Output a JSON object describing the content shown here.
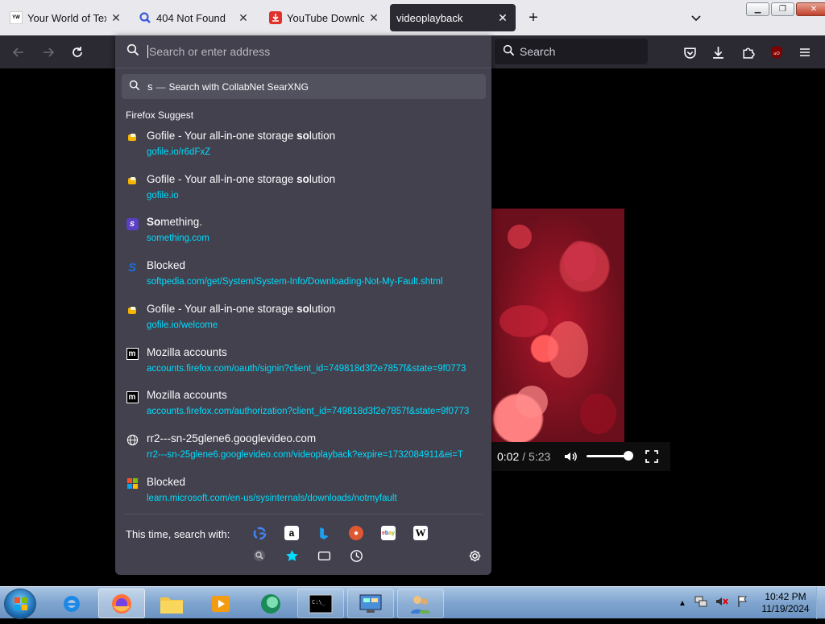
{
  "tabs": [
    {
      "title": "Your World of Text",
      "favicon_text": "YW\nOT"
    },
    {
      "title": "404 Not Found",
      "favicon": "search-icon"
    },
    {
      "title": "YouTube Download",
      "favicon": "download-icon"
    },
    {
      "title": "videoplayback",
      "active": true
    }
  ],
  "navbar": {
    "search_placeholder": "Search"
  },
  "urlbar": {
    "placeholder": "Search or enter address",
    "first_row": {
      "query": "s",
      "separator": "—",
      "action": "Search with CollabNet SearXNG"
    },
    "suggest_header": "Firefox Suggest",
    "results": [
      {
        "title_pre": "Gofile - Your all-in-one storage ",
        "title_bold": "so",
        "title_post": "lution",
        "url": "gofile.io/r6dFxZ",
        "icon": "gofile-icon"
      },
      {
        "title_pre": "Gofile - Your all-in-one storage ",
        "title_bold": "so",
        "title_post": "lution",
        "url": "gofile.io",
        "icon": "gofile-icon"
      },
      {
        "title_pre": "",
        "title_bold": "So",
        "title_post": "mething.",
        "url": "something.com",
        "icon": "something-icon"
      },
      {
        "title_pre": "Blocked",
        "title_bold": "",
        "title_post": "",
        "url": "softpedia.com/get/System/System-Info/Downloading-Not-My-Fault.shtml",
        "icon": "softpedia-icon"
      },
      {
        "title_pre": "Gofile - Your all-in-one storage ",
        "title_bold": "so",
        "title_post": "lution",
        "url": "gofile.io/welcome",
        "icon": "gofile-icon"
      },
      {
        "title_pre": "Mozilla accounts",
        "title_bold": "",
        "title_post": "",
        "url": "accounts.firefox.com/oauth/signin?client_id=749818d3f2e7857f&state=9f0773",
        "icon": "mozilla-icon"
      },
      {
        "title_pre": "Mozilla accounts",
        "title_bold": "",
        "title_post": "",
        "url": "accounts.firefox.com/authorization?client_id=749818d3f2e7857f&state=9f0773",
        "icon": "mozilla-icon"
      },
      {
        "title_pre": "rr2---sn-25glene6.googlevideo.com",
        "title_bold": "",
        "title_post": "",
        "url": "rr2---sn-25glene6.googlevideo.com/videoplayback?expire=1732084911&ei=T",
        "icon": "globe-icon"
      },
      {
        "title_pre": "Blocked",
        "title_bold": "",
        "title_post": "",
        "url": "learn.microsoft.com/en-us/sysinternals/downloads/notmyfault",
        "icon": "microsoft-icon"
      }
    ],
    "this_time_label": "This time, search with:",
    "engines": [
      "google-icon",
      "amazon-icon",
      "bing-icon",
      "duckduckgo-icon",
      "ebay-icon",
      "wikipedia-icon"
    ],
    "modes": [
      "searxng-icon",
      "bookmarks-star-icon",
      "tabs-icon",
      "history-icon"
    ]
  },
  "video": {
    "current_time": "0:02",
    "duration": "/ 5:23",
    "volume": 0.9
  },
  "taskbar": {
    "apps": [
      "internet-explorer-icon",
      "firefox-icon",
      "file-explorer-icon",
      "media-player-icon",
      "app-icon",
      "cmd-icon",
      "control-panel-icon",
      "users-icon"
    ],
    "time": "10:42 PM",
    "date": "11/19/2024"
  }
}
